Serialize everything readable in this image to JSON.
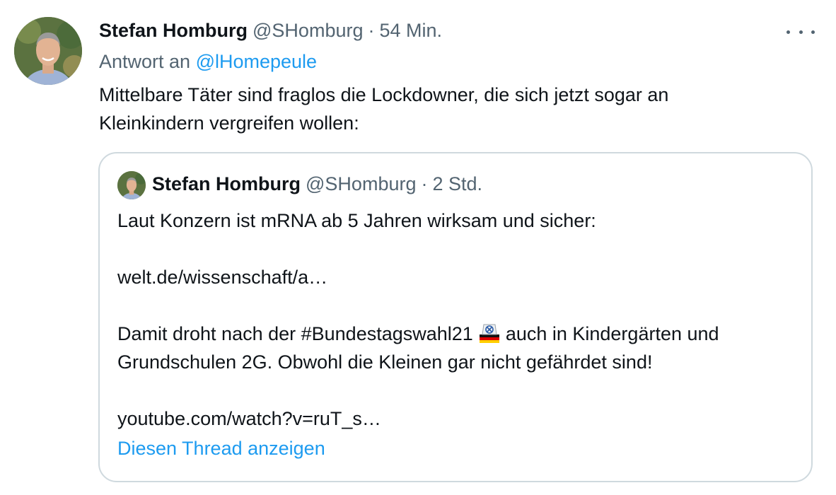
{
  "tweet": {
    "display_name": "Stefan Homburg",
    "handle": "@SHomburg",
    "separator": "·",
    "time": "54 Min.",
    "reply_prefix": "Antwort an ",
    "reply_handle": "@lHomepeule",
    "text_lines": [
      "Mittelbare Täter sind fraglos die Lockdowner, die sich jetzt sogar an",
      "Kleinkindern vergreifen wollen:"
    ]
  },
  "quote": {
    "display_name": "Stefan Homburg",
    "handle": "@SHomburg",
    "separator": "·",
    "time": "2 Std.",
    "line1": "Laut Konzern ist mRNA ab 5 Jahren wirksam und sicher:",
    "link1": "welt.de/wissenschaft/a…",
    "line3_before_emoji": "Damit droht nach der #Bundestagswahl21",
    "line3_after_emoji": "auch in Kindergärten und",
    "line4": "Grundschulen 2G. Obwohl die Kleinen gar nicht gefährdet sind!",
    "link2": "youtube.com/watch?v=ruT_s…",
    "thread_link": "Diesen Thread anzeigen"
  },
  "icons": {
    "more": "more-options-icon",
    "ballot": "ballot-box-germany-emoji"
  },
  "colors": {
    "link": "#1d9bf0",
    "secondary_text": "#536471",
    "border": "#cfd9de"
  }
}
